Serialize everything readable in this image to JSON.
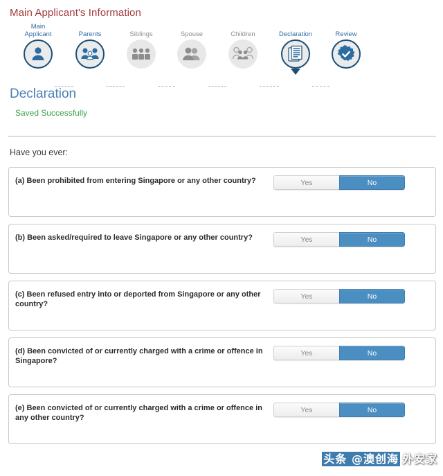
{
  "page": {
    "title": "Main Applicant's Information",
    "section_heading": "Declaration",
    "saved_message": "Saved Successfully",
    "prompt": "Have you ever:",
    "title_color": "#a23b3b",
    "heading_color": "#4a7fb5",
    "success_color": "#3ca04a",
    "accent_color": "#4a8ec2",
    "active_step_color": "#1c4f77",
    "inactive_step_color": "#8d8d8d"
  },
  "stepper": {
    "steps": [
      {
        "label": "Main\nApplicant",
        "label_line1": "Main",
        "label_line2": "Applicant",
        "icon": "single-person-icon",
        "state": "active"
      },
      {
        "label": "Parents",
        "label_line1": "Parents",
        "label_line2": "",
        "icon": "parents-group-icon",
        "state": "active"
      },
      {
        "label": "Siblings",
        "label_line1": "Siblings",
        "label_line2": "",
        "icon": "siblings-group-icon",
        "state": "inactive"
      },
      {
        "label": "Spouse",
        "label_line1": "Spouse",
        "label_line2": "",
        "icon": "couple-icon",
        "state": "inactive"
      },
      {
        "label": "Children",
        "label_line1": "Children",
        "label_line2": "",
        "icon": "children-group-icon",
        "state": "inactive"
      },
      {
        "label": "Declaration",
        "label_line1": "Declaration",
        "label_line2": "",
        "icon": "document-icon",
        "state": "active",
        "current": true
      },
      {
        "label": "Review",
        "label_line1": "Review",
        "label_line2": "",
        "icon": "check-badge-icon",
        "state": "active"
      }
    ]
  },
  "toggle": {
    "yes_label": "Yes",
    "no_label": "No"
  },
  "questions": [
    {
      "text": "(a) Been prohibited from entering Singapore or any other country?",
      "answer": "No"
    },
    {
      "text": "(b) Been asked/required to leave Singapore or any other country?",
      "answer": "No"
    },
    {
      "text": "(c) Been refused entry into or deported from Singapore or any other country?",
      "answer": "No"
    },
    {
      "text": "(d) Been convicted of or currently charged with a crime or offence in Singapore?",
      "answer": "No"
    },
    {
      "text": "(e) Been convicted of or currently charged with a crime or offence in any other country?",
      "answer": "No"
    }
  ],
  "watermark": {
    "highlighted": "头条 @澳创海",
    "plain": "外安家"
  }
}
